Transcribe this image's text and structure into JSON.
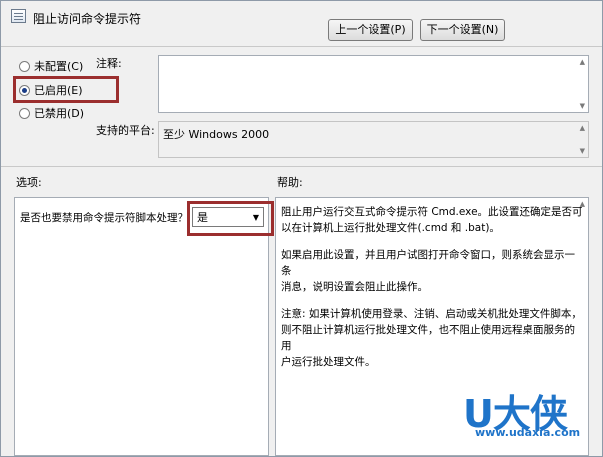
{
  "window": {
    "title": "阻止访问命令提示符",
    "title_icon": "policy-setting-icon"
  },
  "nav": {
    "prev_label": "上一个设置(P)",
    "next_label": "下一个设置(N)"
  },
  "state": {
    "options": [
      {
        "label": "未配置(C)",
        "checked": false
      },
      {
        "label": "已启用(E)",
        "checked": true
      },
      {
        "label": "已禁用(D)",
        "checked": false
      }
    ]
  },
  "comment": {
    "label": "注释:",
    "value": ""
  },
  "platform": {
    "label": "支持的平台:",
    "value": "至少 Windows 2000"
  },
  "options_section": {
    "label": "选项:",
    "question": "是否也要禁用命令提示符脚本处理？",
    "selected": "是"
  },
  "help_section": {
    "label": "帮助:",
    "paragraphs": [
      [
        "阻止用户运行交互式命令提示符 Cmd.exe。此设置还确定是否可",
        "以在计算机上运行批处理文件(.cmd 和 .bat)。"
      ],
      [
        "如果启用此设置，并且用户试图打开命令窗口，则系统会显示一条",
        "消息，说明设置会阻止此操作。"
      ],
      [
        "注意: 如果计算机使用登录、注销、启动或关机批处理文件脚本，",
        "则不阻止计算机运行批处理文件，也不阻止使用远程桌面服务的用",
        "户运行批处理文件。"
      ]
    ]
  },
  "watermark": {
    "brand": "U大侠",
    "url": "www.udaxia.com"
  },
  "colors": {
    "highlight": "#9b2e2e",
    "watermark": "#1f74c9",
    "radio_dot": "#1a3c87"
  }
}
